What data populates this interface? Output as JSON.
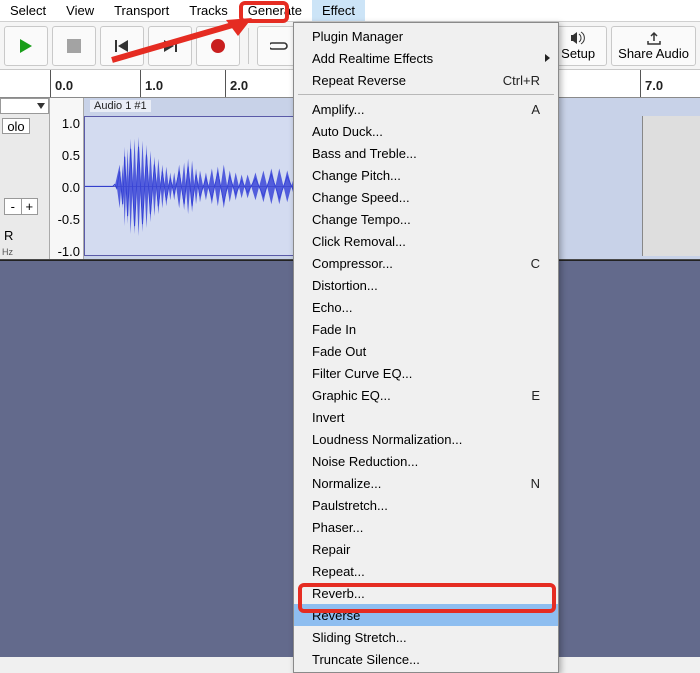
{
  "menubar": {
    "items": [
      "Select",
      "View",
      "Transport",
      "Tracks",
      "Generate",
      "Effect"
    ],
    "active_index": 5
  },
  "toolbar": {
    "setup_label": "Setup",
    "share_label": "Share Audio"
  },
  "ruler": {
    "ticks": [
      "0.0",
      "1.0",
      "2.0",
      "7.0"
    ]
  },
  "track": {
    "panel": {
      "solo": "olo",
      "channel": "R",
      "hz": "Hz",
      "plus": "+",
      "minus": "-"
    },
    "vscale": [
      "1.0",
      "0.5",
      "0.0",
      "-0.5",
      "-1.0"
    ],
    "name": "Audio 1 #1"
  },
  "effect_menu": {
    "top": [
      {
        "label": "Plugin Manager"
      },
      {
        "label": "Add Realtime Effects",
        "submenu": true
      },
      {
        "label": "Repeat Reverse",
        "shortcut": "Ctrl+R"
      }
    ],
    "effects": [
      {
        "label": "Amplify...",
        "shortcut": "A"
      },
      {
        "label": "Auto Duck..."
      },
      {
        "label": "Bass and Treble..."
      },
      {
        "label": "Change Pitch..."
      },
      {
        "label": "Change Speed..."
      },
      {
        "label": "Change Tempo..."
      },
      {
        "label": "Click Removal..."
      },
      {
        "label": "Compressor...",
        "shortcut": "C"
      },
      {
        "label": "Distortion..."
      },
      {
        "label": "Echo..."
      },
      {
        "label": "Fade In"
      },
      {
        "label": "Fade Out"
      },
      {
        "label": "Filter Curve EQ..."
      },
      {
        "label": "Graphic EQ...",
        "shortcut": "E"
      },
      {
        "label": "Invert"
      },
      {
        "label": "Loudness Normalization..."
      },
      {
        "label": "Noise Reduction..."
      },
      {
        "label": "Normalize...",
        "shortcut": "N"
      },
      {
        "label": "Paulstretch..."
      },
      {
        "label": "Phaser..."
      },
      {
        "label": "Repair"
      },
      {
        "label": "Repeat..."
      },
      {
        "label": "Reverb..."
      },
      {
        "label": "Reverse",
        "hover": true
      },
      {
        "label": "Sliding Stretch..."
      },
      {
        "label": "Truncate Silence..."
      }
    ]
  },
  "annotation": {
    "arrow_color": "#e52c22"
  }
}
